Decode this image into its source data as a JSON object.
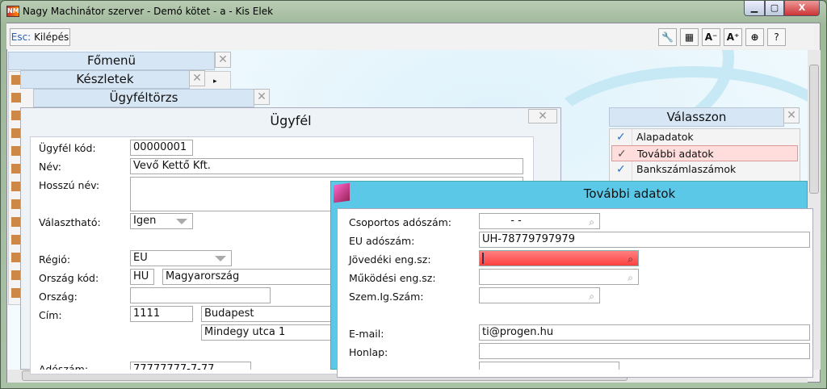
{
  "window": {
    "title": "Nagy Machinátor szerver - Demó kötet - a - Kis Elek",
    "app_icon": "NM",
    "min": "▁",
    "max": "▢",
    "close": "X"
  },
  "toolbar": {
    "esc_key": "Esc:",
    "esc_label": "Kilépés",
    "icons": [
      "wrench-icon",
      "grid-icon",
      "font-decrease-icon",
      "font-increase-icon",
      "lifebuoy-icon",
      "help-icon"
    ],
    "font_dec": "A⁻",
    "font_inc": "A⁺",
    "help": "?"
  },
  "panels": {
    "fomenu": "Főmenü",
    "keszletek": "Készletek",
    "ugyfeltorzs": "Ügyféltörzs",
    "close": "✕"
  },
  "ugyfel": {
    "title": "Ügyfél",
    "close": "✕",
    "fields": {
      "kod_label": "Ügyfél kód:",
      "kod": "00000001",
      "nev_label": "Név:",
      "nev": "Vevő Kettő Kft.",
      "hosszu_label": "Hosszú név:",
      "hosszu": "",
      "valaszthato_label": "Választható:",
      "valaszthato": "Igen",
      "regio_label": "Régió:",
      "regio": "EU",
      "orszagkod_label": "Ország kód:",
      "orszagkod": "HU",
      "orszagnev": "Magyarország",
      "orszag_label": "Ország:",
      "orszag": "",
      "cim_label": "Cím:",
      "irsz": "1111",
      "varos": "Budapest",
      "utca": "Mindegy utca 1",
      "adoszam_label": "Adószám:",
      "adoszam": "77777777-7-77"
    }
  },
  "valasszon": {
    "title": "Válasszon",
    "close": "✕",
    "items": [
      {
        "label": "Alapadatok",
        "checked": true,
        "selected": false
      },
      {
        "label": "További adatok",
        "checked": true,
        "selected": true
      },
      {
        "label": "Bankszámlaszámok",
        "checked": true,
        "selected": false
      }
    ]
  },
  "tovabbi": {
    "title": "További adatok",
    "fields": {
      "csop_label": "Csoportos adószám:",
      "csop": "  - -",
      "eu_label": "EU adószám:",
      "eu": "UH-78779797979",
      "jov_label": "Jövedéki eng.sz:",
      "jov": "",
      "mukod_label": "Működési eng.sz:",
      "mukod": "",
      "szem_label": "Szem.Ig.Szám:",
      "szem": "",
      "email_label": "E-mail:",
      "email": "ti@progen.hu",
      "honlap_label": "Honlap:",
      "honlap": ""
    },
    "error_color": "#ff4b4b",
    "title_color": "#5cc8e8"
  }
}
